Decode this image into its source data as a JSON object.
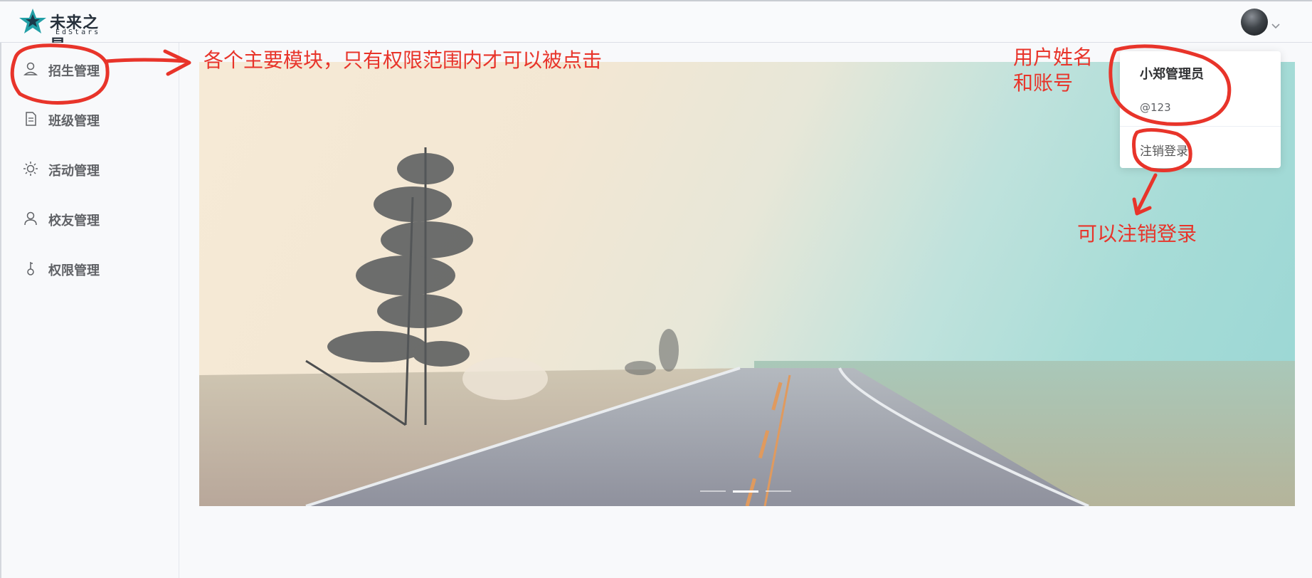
{
  "header": {
    "logo_title": "未来之星",
    "logo_subtitle": "EdStars",
    "avatar_icon": "user-avatar"
  },
  "sidebar": {
    "items": [
      {
        "label": "招生管理",
        "icon": "user-icon"
      },
      {
        "label": "班级管理",
        "icon": "document-icon"
      },
      {
        "label": "活动管理",
        "icon": "sun-icon"
      },
      {
        "label": "校友管理",
        "icon": "user-icon"
      },
      {
        "label": "权限管理",
        "icon": "key-icon"
      }
    ]
  },
  "carousel": {
    "slide_count": 3,
    "active_index": 1
  },
  "user_dropdown": {
    "name": "小郑管理员",
    "account": "@123",
    "logout_label": "注销登录"
  },
  "annotations": {
    "modules_note": "各个主要模块，只有权限范围内才可以被点击",
    "user_note_line1": "用户姓名",
    "user_note_line2": "和账号",
    "logout_note": "可以注销登录"
  },
  "colors": {
    "annotation": "#e8342a",
    "sidebar_text": "#606266",
    "logo_teal": "#23a0a7"
  }
}
